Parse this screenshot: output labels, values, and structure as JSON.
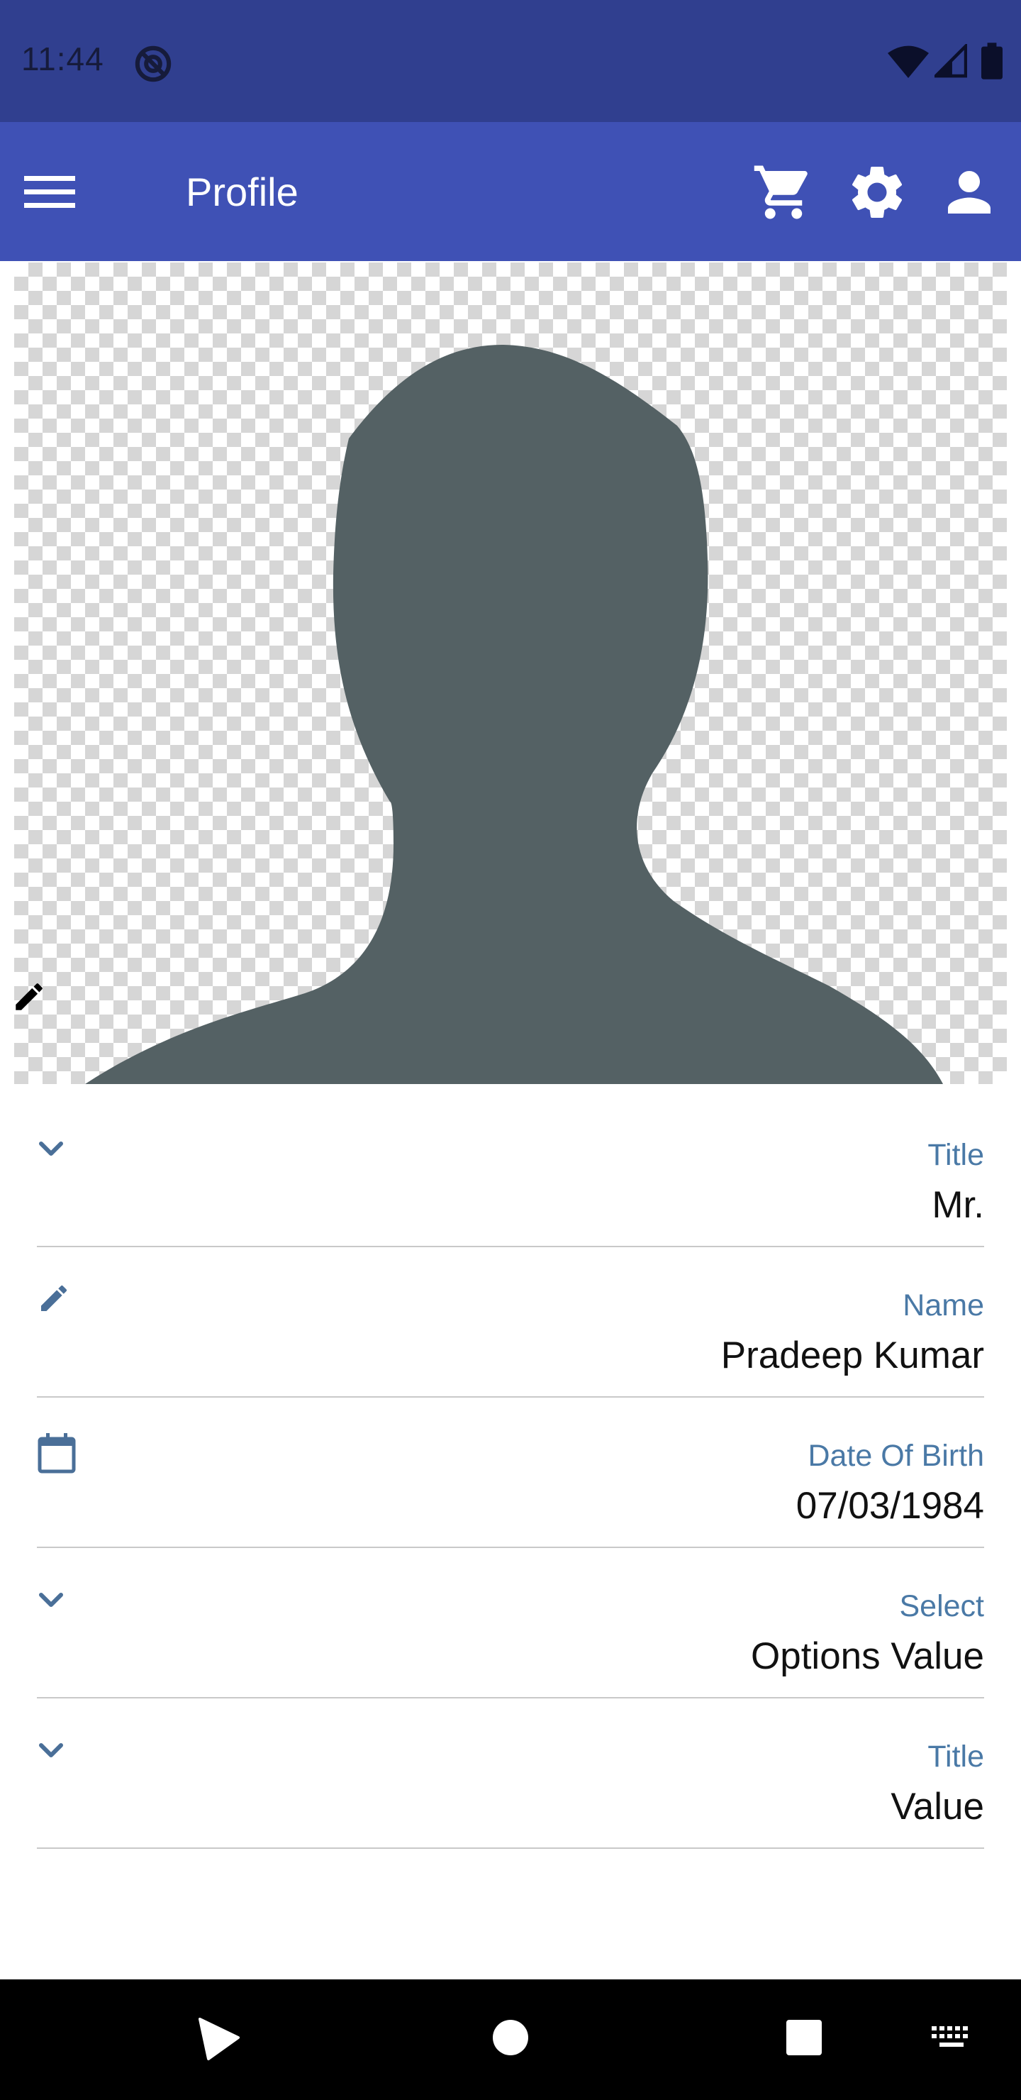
{
  "status_bar": {
    "time": "11:44",
    "icons": [
      "do-not-disturb-icon",
      "wifi-icon",
      "cell-signal-icon",
      "battery-icon"
    ]
  },
  "app_bar": {
    "title": "Profile",
    "menu_icon": "hamburger-menu-icon",
    "actions": [
      "cart-icon",
      "settings-gear-icon",
      "account-person-icon"
    ],
    "background_color": "#3f51b5"
  },
  "profile_photo": {
    "image": "default-person-silhouette",
    "edit_icon": "pencil-icon"
  },
  "form": {
    "fields": [
      {
        "icon": "chevron-down-icon",
        "label": "Title",
        "value": "Mr."
      },
      {
        "icon": "pencil-icon",
        "label": "Name",
        "value": "Pradeep Kumar"
      },
      {
        "icon": "calendar-icon",
        "label": "Date Of Birth",
        "value": "07/03/1984"
      },
      {
        "icon": "chevron-down-icon",
        "label": "Select",
        "value": "Options Value"
      },
      {
        "icon": "chevron-down-icon",
        "label": "Title",
        "value": "Value"
      }
    ],
    "label_color": "#4a79a6"
  },
  "nav_bar": {
    "buttons": [
      "back-icon",
      "home-icon",
      "recents-icon",
      "keyboard-icon"
    ]
  }
}
